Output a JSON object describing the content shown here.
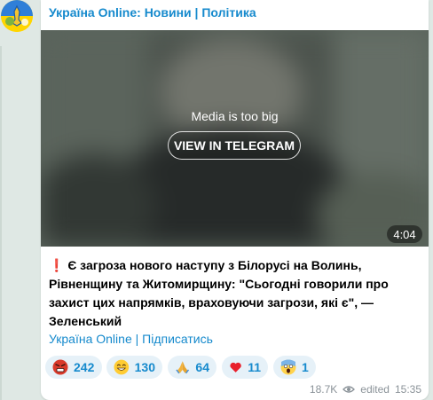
{
  "channel": {
    "name": "Україна Online: Новини | Політика",
    "footer_link": "Україна Online | Підписатись"
  },
  "media": {
    "notice": "Media is too big",
    "button_label": "VIEW IN TELEGRAM",
    "duration": "4:04"
  },
  "post": {
    "emoji": "❗",
    "text": "Є загроза нового наступу з Білорусі на Волинь, Рівненщину та Житомирщину: \"Сьогодні говорили про захист цих напрямків, враховуючи загрози, які є\", — Зеленський"
  },
  "reactions": [
    {
      "emoji": "angry-face",
      "count": "242"
    },
    {
      "emoji": "grinning-face",
      "count": "130"
    },
    {
      "emoji": "folded-hands",
      "count": "64"
    },
    {
      "emoji": "red-heart",
      "count": "11"
    },
    {
      "emoji": "screaming-face",
      "count": "1"
    }
  ],
  "meta": {
    "views": "18.7K",
    "edited": "edited",
    "time": "15:35"
  },
  "colors": {
    "link": "#168acd",
    "reaction_bg": "#e6f1f8",
    "meta": "#8a9298"
  }
}
